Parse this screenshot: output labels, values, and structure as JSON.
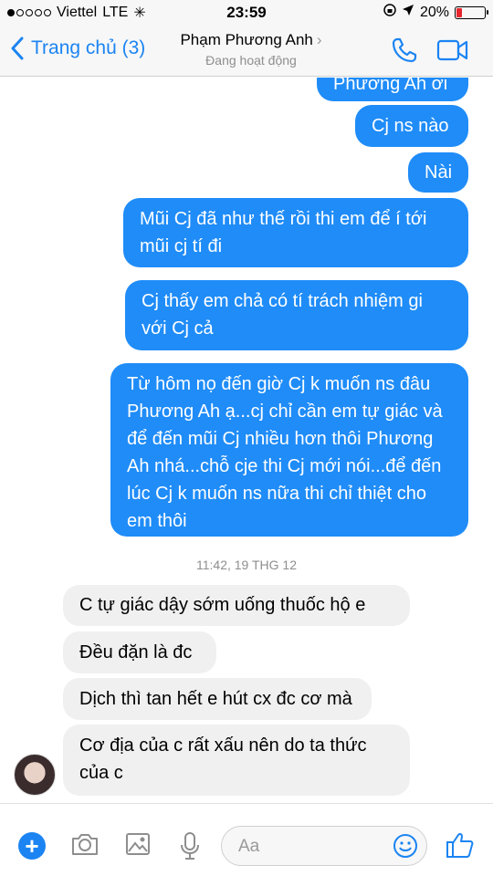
{
  "status_bar": {
    "carrier": "Viettel",
    "network": "LTE",
    "time": "23:59",
    "battery": "20%",
    "battery_level": 0.2,
    "battery_color": "#e6262c"
  },
  "nav": {
    "back_label": "Trang chủ (3)",
    "contact_name": "Phạm Phương Anh",
    "contact_status": "Đang hoạt động",
    "accent_color": "#1b84f2",
    "icons": [
      "chevron-left-icon",
      "phone-icon",
      "video-camera-icon"
    ]
  },
  "messages": [
    {
      "side": "out",
      "text": "Phương Ah ơi"
    },
    {
      "side": "out",
      "text": "Cj ns nào"
    },
    {
      "side": "out",
      "text": "Nài"
    },
    {
      "side": "out",
      "text": "Mũi Cj đã như thế rồi thi em để í tới mũi cj tí đi"
    },
    {
      "side": "out",
      "text": "Cj thấy em chả có tí trách nhiệm gi với Cj cả"
    },
    {
      "side": "out",
      "text": "Từ hôm nọ đến giờ Cj k muốn ns đâu Phương Ah ạ...cj chỉ cần em tự giác và để đến mũi Cj nhiều hơn thôi Phương Ah nhá...chỗ cje thi Cj mới nói...để đến lúc Cj k muốn ns nữa thi chỉ thiệt cho em thôi"
    },
    {
      "side": "in",
      "text": "C tự giác dậy sớm uống thuốc hộ e"
    },
    {
      "side": "in",
      "text": "Đều đặn là đc"
    },
    {
      "side": "in",
      "text": "Dịch thì tan hết e hút cx đc cơ mà"
    },
    {
      "side": "in",
      "text": "Cơ địa của c rất xấu nên do ta thức của c"
    }
  ],
  "timestamp": "11:42, 19 THG 12",
  "composer": {
    "placeholder": "Aa",
    "icons": [
      "plus-icon",
      "camera-icon",
      "image-icon",
      "microphone-icon",
      "emoji-icon",
      "thumbs-up-icon"
    ]
  },
  "colors": {
    "outgoing_bubble": "#1f8cf8",
    "incoming_bubble": "#f1f0f0"
  }
}
